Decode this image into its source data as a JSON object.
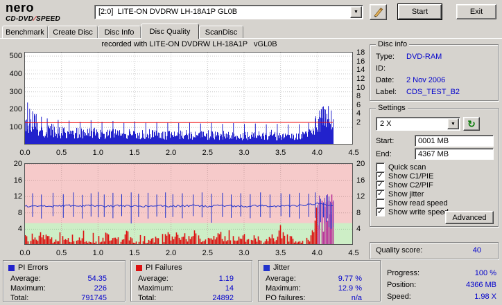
{
  "logo": {
    "name": "nero",
    "product_a": "CD-DVD",
    "separator": "∕",
    "product_b": "SPEED"
  },
  "toolbar": {
    "drive": "[2:0]  LITE-ON DVDRW LH-18A1P GL0B",
    "start_label": "Start",
    "exit_label": "Exit"
  },
  "tabs": [
    {
      "label": "Benchmark"
    },
    {
      "label": "Create Disc"
    },
    {
      "label": "Disc Info"
    },
    {
      "label": "Disc Quality"
    },
    {
      "label": "ScanDisc"
    }
  ],
  "active_tab": "Disc Quality",
  "chart_title": "recorded with LITE-ON DVDRW LH-18A1P   vGL0B",
  "disc_info": {
    "title": "Disc info",
    "rows": [
      {
        "label": "Type:",
        "value": "DVD-RAM"
      },
      {
        "label": "ID:",
        "value": ""
      },
      {
        "label": "Date:",
        "value": "2 Nov 2006"
      },
      {
        "label": "Label:",
        "value": "CDS_TEST_B2"
      }
    ]
  },
  "settings": {
    "title": "Settings",
    "speed_value": "2 X",
    "start_label": "Start:",
    "start_value": "0001 MB",
    "end_label": "End:",
    "end_value": "4367 MB",
    "checkboxes": [
      {
        "label": "Quick scan",
        "checked": false
      },
      {
        "label": "Show C1/PIE",
        "checked": true
      },
      {
        "label": "Show C2/PIF",
        "checked": true
      },
      {
        "label": "Show jitter",
        "checked": true
      },
      {
        "label": "Show read speed",
        "checked": false
      },
      {
        "label": "Show write speed",
        "checked": true
      }
    ],
    "advanced_label": "Advanced"
  },
  "quality": {
    "label": "Quality score:",
    "value": "40"
  },
  "stats": {
    "pi_errors": {
      "title": "PI Errors",
      "rows": [
        {
          "label": "Average:",
          "value": "54.35"
        },
        {
          "label": "Maximum:",
          "value": "226"
        },
        {
          "label": "Total:",
          "value": "791745"
        }
      ]
    },
    "pi_failures": {
      "title": "PI Failures",
      "rows": [
        {
          "label": "Average:",
          "value": "1.19"
        },
        {
          "label": "Maximum:",
          "value": "14"
        },
        {
          "label": "Total:",
          "value": "24892"
        }
      ]
    },
    "jitter": {
      "title": "Jitter",
      "rows": [
        {
          "label": "Average:",
          "value": "9.77 %"
        },
        {
          "label": "Maximum:",
          "value": "12.9 %"
        },
        {
          "label": "PO failures:",
          "value": "n/a"
        }
      ]
    }
  },
  "status": {
    "rows": [
      {
        "label": "Progress:",
        "value": "100 %"
      },
      {
        "label": "Position:",
        "value": "4366 MB"
      },
      {
        "label": "Speed:",
        "value": "1.98 X"
      }
    ]
  },
  "icons": {
    "dropdown": "▼",
    "refresh": "↻",
    "check": "✓"
  },
  "colors": {
    "value_text": "#0000cc",
    "pi_errors": "#2222cc",
    "pi_failures": "#dd1111",
    "jitter": "#2233cc",
    "write_speed": "#ee0000"
  },
  "chart_data": [
    {
      "type": "area",
      "title": "recorded with LITE-ON DVDRW LH-18A1P   vGL0B",
      "x_ticks": [
        "0.0",
        "0.5",
        "1.0",
        "1.5",
        "2.0",
        "2.5",
        "3.0",
        "3.5",
        "4.0",
        "4.5"
      ],
      "xlim": [
        0,
        4.5
      ],
      "data_end": 4.22,
      "left_axis": {
        "ticks": [
          500,
          400,
          300,
          200,
          100
        ],
        "max": 520
      },
      "right_axis": {
        "ticks": [
          18,
          16,
          14,
          12,
          10,
          8,
          6,
          4,
          2
        ]
      },
      "series": [
        {
          "name": "PI Errors",
          "type": "noisy-area",
          "color": "#2222cc",
          "x_step": 0.1,
          "values": [
            140,
            115,
            100,
            92,
            88,
            85,
            82,
            80,
            78,
            82,
            78,
            75,
            78,
            74,
            72,
            75,
            72,
            74,
            70,
            68,
            72,
            68,
            70,
            66,
            64,
            68,
            64,
            66,
            62,
            64,
            62,
            60,
            63,
            60,
            62,
            58,
            60,
            62,
            66,
            80,
            150,
            185,
            175
          ]
        },
        {
          "name": "Write speed",
          "type": "line",
          "axis": "right",
          "color": "#ee0000",
          "points": [
            [
              0,
              1.95
            ],
            [
              2.0,
              1.97
            ],
            [
              4.22,
              2.02
            ]
          ]
        }
      ],
      "spikes": [
        [
          0.03,
          240
        ],
        [
          0.06,
          205
        ],
        [
          0.1,
          190
        ],
        [
          0.15,
          175
        ],
        [
          0.22,
          160
        ],
        [
          0.3,
          150
        ],
        [
          0.45,
          142
        ],
        [
          0.6,
          138
        ],
        [
          0.75,
          132
        ],
        [
          0.9,
          140
        ],
        [
          1.05,
          132
        ],
        [
          1.2,
          136
        ],
        [
          1.35,
          128
        ],
        [
          1.5,
          133
        ],
        [
          1.65,
          126
        ],
        [
          1.8,
          130
        ],
        [
          1.95,
          127
        ],
        [
          2.1,
          124
        ],
        [
          2.25,
          129
        ],
        [
          2.4,
          122
        ],
        [
          2.55,
          126
        ],
        [
          2.7,
          120
        ],
        [
          2.85,
          124
        ],
        [
          3.0,
          119
        ],
        [
          3.15,
          122
        ],
        [
          3.3,
          117
        ],
        [
          3.45,
          120
        ],
        [
          3.6,
          116
        ],
        [
          3.75,
          118
        ],
        [
          3.88,
          125
        ],
        [
          3.97,
          150
        ],
        [
          4.03,
          195
        ],
        [
          4.07,
          215
        ],
        [
          4.11,
          200
        ],
        [
          4.15,
          220
        ],
        [
          4.19,
          195
        ]
      ]
    },
    {
      "type": "mixed",
      "x_ticks": [
        "0.0",
        "0.5",
        "1.0",
        "1.5",
        "2.0",
        "2.5",
        "3.0",
        "3.5",
        "4.0",
        "4.5"
      ],
      "xlim": [
        0,
        4.5
      ],
      "data_end": 4.22,
      "left_axis": {
        "ticks": [
          20,
          16,
          12,
          8,
          4
        ],
        "max": 20
      },
      "right_axis": {
        "ticks": [
          20,
          16,
          12,
          8,
          4
        ]
      },
      "zones": [
        {
          "from": 0,
          "to": 5.5,
          "color": "#cdeec6"
        },
        {
          "from": 5.5,
          "to": 20,
          "color": "#f6caca"
        }
      ],
      "series": [
        {
          "name": "PI Failures",
          "type": "bars",
          "color": "#dd1111",
          "x_step": 0.1,
          "values": [
            2.0,
            1.6,
            2.4,
            2.0,
            1.2,
            2.0,
            1.6,
            2.8,
            2.0,
            1.6,
            2.0,
            2.4,
            1.6,
            2.0,
            2.8,
            1.6,
            2.0,
            1.2,
            2.4,
            2.0,
            3.6,
            2.0,
            1.6,
            2.0,
            2.4,
            1.6,
            2.0,
            2.8,
            2.0,
            1.6,
            2.4,
            2.0,
            1.6,
            2.0,
            2.4,
            2.8,
            2.0,
            1.6,
            2.0,
            2.4,
            8.0,
            10.0,
            9.0
          ]
        },
        {
          "name": "Jitter",
          "type": "noisy-line",
          "color": "#2233cc",
          "x_step": 0.1,
          "values": [
            9.6,
            9.7,
            9.8,
            9.7,
            9.6,
            9.7,
            9.8,
            9.7,
            9.7,
            9.8,
            9.7,
            9.6,
            9.7,
            9.8,
            9.7,
            9.7,
            9.6,
            9.7,
            9.8,
            9.7,
            9.6,
            9.7,
            9.7,
            9.8,
            9.7,
            9.6,
            9.7,
            9.8,
            9.7,
            9.7,
            9.6,
            9.7,
            9.8,
            9.7,
            9.6,
            9.7,
            9.7,
            9.8,
            9.9,
            10.0,
            10.3,
            10.1,
            9.9
          ]
        }
      ],
      "jitter_spikes": [
        [
          0.1,
          7.0,
          12.8
        ],
        [
          0.22,
          6.6,
          12.5
        ],
        [
          0.38,
          7.2,
          12.9
        ],
        [
          0.52,
          6.8,
          12.6
        ],
        [
          0.66,
          7.0,
          13.0
        ],
        [
          0.78,
          6.6,
          12.4
        ],
        [
          0.9,
          7.1,
          12.8
        ],
        [
          1.0,
          6.9,
          13.1
        ],
        [
          1.08,
          7.0,
          12.5
        ],
        [
          1.2,
          6.7,
          12.9
        ],
        [
          1.32,
          7.2,
          12.6
        ],
        [
          1.45,
          5.4,
          13.0
        ],
        [
          1.55,
          7.0,
          12.7
        ],
        [
          1.68,
          6.6,
          12.9
        ],
        [
          1.8,
          7.1,
          12.5
        ],
        [
          1.92,
          6.8,
          13.0
        ],
        [
          2.02,
          7.0,
          12.6
        ],
        [
          2.15,
          6.7,
          12.8
        ],
        [
          2.3,
          7.2,
          12.5
        ],
        [
          2.42,
          6.9,
          13.0
        ],
        [
          2.55,
          5.6,
          12.7
        ],
        [
          2.7,
          7.0,
          12.9
        ],
        [
          2.82,
          6.8,
          12.5
        ],
        [
          2.95,
          7.1,
          12.8
        ],
        [
          3.08,
          6.7,
          12.6
        ],
        [
          3.22,
          7.0,
          13.0
        ],
        [
          3.35,
          6.8,
          12.5
        ],
        [
          3.5,
          7.2,
          12.8
        ],
        [
          3.62,
          6.9,
          12.6
        ],
        [
          3.75,
          6.6,
          12.9
        ],
        [
          3.88,
          7.0,
          12.7
        ],
        [
          3.97,
          6.8,
          13.0
        ]
      ],
      "end_cluster": {
        "x0": 4.0,
        "x1": 4.22,
        "bar_color": "#bb3399",
        "spike_color": "#7733bb"
      }
    }
  ]
}
